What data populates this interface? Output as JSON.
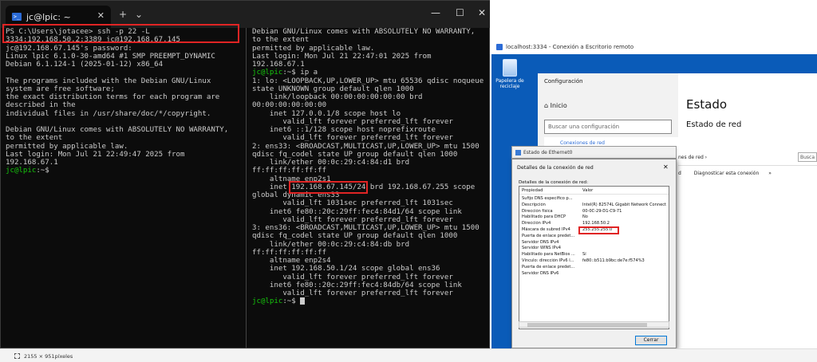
{
  "terminal": {
    "tab_title": "jc@lpic: ~",
    "tab_close": "✕",
    "new_tab": "+",
    "dropdown": "⌄",
    "win_min": "—",
    "win_max": "☐",
    "win_close": "✕",
    "left_lines": [
      "PS C:\\Users\\jotacee> ssh -p 22 -L 3334:192.168.50.2:3389 jc@192.168.67.145",
      "jc@192.168.67.145's password:",
      "Linux lpic 6.1.0-30-amd64 #1 SMP PREEMPT_DYNAMIC Debian 6.1.124-1 (2025-01-12) x86_64",
      "",
      "The programs included with the Debian GNU/Linux system are free software;",
      "the exact distribution terms for each program are described in the",
      "individual files in /usr/share/doc/*/copyright.",
      "",
      "Debian GNU/Linux comes with ABSOLUTELY NO WARRANTY, to the extent",
      "permitted by applicable law.",
      "Last login: Mon Jul 21 22:49:47 2025 from 192.168.67.1"
    ],
    "left_prompt": "jc@lpic",
    "left_prompt_rest": ":~$",
    "right_lines": [
      "Debian GNU/Linux comes with ABSOLUTELY NO WARRANTY, to the extent",
      "permitted by applicable law.",
      "Last login: Mon Jul 21 22:47:01 2025 from 192.168.67.1"
    ],
    "right_cmd_prompt": "jc@lpic",
    "right_cmd_rest": ":~$ ip a",
    "right_output": [
      "1: lo: <LOOPBACK,UP,LOWER_UP> mtu 65536 qdisc noqueue state UNKNOWN group default qlen 1000",
      "    link/loopback 00:00:00:00:00:00 brd 00:00:00:00:00:00",
      "    inet 127.0.0.1/8 scope host lo",
      "       valid_lft forever preferred_lft forever",
      "    inet6 ::1/128 scope host noprefixroute",
      "       valid_lft forever preferred_lft forever",
      "2: ens33: <BROADCAST,MULTICAST,UP,LOWER_UP> mtu 1500 qdisc fq_codel state UP group default qlen 1000",
      "    link/ether 00:0c:29:c4:84:d1 brd ff:ff:ff:ff:ff:ff",
      "    altname enp2s1"
    ],
    "inet_prefix": "    inet ",
    "inet_ip": "192.168.67.145/24",
    "inet_suffix": " brd 192.168.67.255 scope global dynamic ens33",
    "right_output2": [
      "       valid_lft 1031sec preferred_lft 1031sec",
      "    inet6 fe80::20c:29ff:fec4:84d1/64 scope link",
      "       valid_lft forever preferred_lft forever",
      "3: ens36: <BROADCAST,MULTICAST,UP,LOWER_UP> mtu 1500 qdisc fq_codel state UP group default qlen 1000",
      "    link/ether 00:0c:29:c4:84:db brd ff:ff:ff:ff:ff:ff",
      "    altname enp2s4",
      "    inet 192.168.50.1/24 scope global ens36",
      "       valid_lft forever preferred_lft forever",
      "    inet6 fe80::20c:29ff:fec4:84db/64 scope link",
      "       valid_lft forever preferred_lft forever"
    ],
    "right_prompt": "jc@lpic",
    "right_prompt_rest": ":~$ "
  },
  "rdp": {
    "title": "localhost:3334 - Conexión a Escritorio remoto",
    "recycle_label": "Papelera de reciclaje"
  },
  "settings": {
    "title": "Configuración",
    "home": "Inicio",
    "search_placeholder": "Buscar una configuración",
    "heading": "Estado",
    "subheading": "Estado de red",
    "network_connections": "Conexiones de red",
    "breadcrumb_tail": "nes de red  ›",
    "search_short": "Busca",
    "diag_prefix": "d",
    "diagnose": "Diagnosticar esta conexión",
    "more": "»"
  },
  "ethernet": {
    "title": "Estado de Ethernet0"
  },
  "details": {
    "title": "Detalles de la conexión de red",
    "close": "✕",
    "label": "Detalles de la conexión de red:",
    "col_prop": "Propiedad",
    "col_val": "Valor",
    "rows": [
      {
        "p": "Sufijo DNS específico p...",
        "v": ""
      },
      {
        "p": "Descripción",
        "v": "Intel(R) 82574L Gigabit Network Connect"
      },
      {
        "p": "Dirección física",
        "v": "00-0C-29-D1-C9-71"
      },
      {
        "p": "Habilitado para DHCP",
        "v": "No"
      },
      {
        "p": "Dirección IPv4",
        "v": "192.168.50.2"
      },
      {
        "p": "Máscara de subred IPv4",
        "v": "255.255.255.0"
      },
      {
        "p": "Puerta de enlace predet...",
        "v": ""
      },
      {
        "p": "Servidor DNS IPv4",
        "v": ""
      },
      {
        "p": "Servidor WINS IPv4",
        "v": ""
      },
      {
        "p": "Habilitado para NetBios ...",
        "v": "Sí"
      },
      {
        "p": "Vínculo: dirección IPv6 l...",
        "v": "fe80::b511:b9bc:de7e:f574%3"
      },
      {
        "p": "Puerta de enlace predet...",
        "v": ""
      },
      {
        "p": "Servidor DNS IPv6",
        "v": ""
      }
    ],
    "close_button": "Cerrar"
  },
  "statusbar": {
    "dimensions": "2155 × 951píxeles"
  },
  "colors": {
    "terminal_bg": "#0c0c0c",
    "prompt_green": "#16c60c",
    "highlight_red": "#e02424",
    "rdp_blue": "#0a5bb8"
  }
}
